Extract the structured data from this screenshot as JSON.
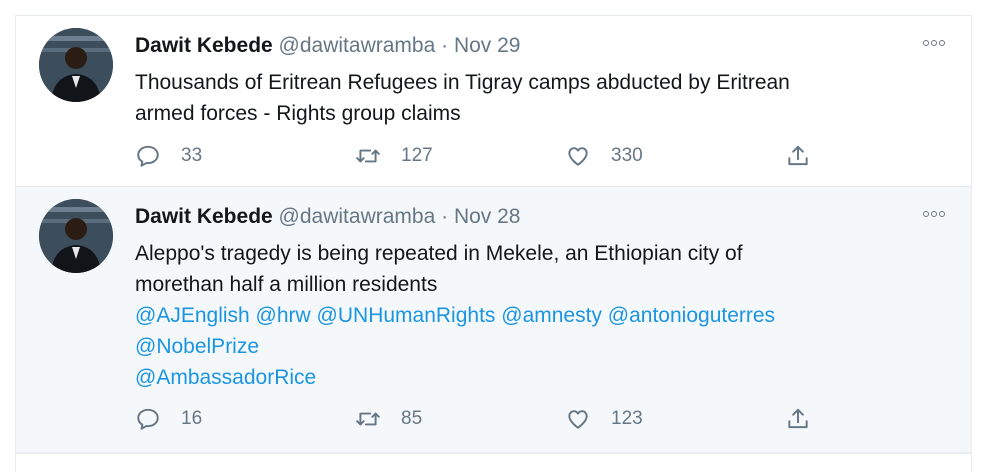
{
  "tweets": [
    {
      "author_name": "Dawit Kebede",
      "handle": "@dawitawramba",
      "separator": "·",
      "date": "Nov 29",
      "text_lines": [
        "Thousands of Eritrean Refugees in Tigray camps abducted by Eritrean",
        "armed forces - Rights group claims"
      ],
      "replies": "33",
      "retweets": "127",
      "likes": "330"
    },
    {
      "author_name": "Dawit Kebede",
      "handle": "@dawitawramba",
      "separator": "·",
      "date": "Nov 28",
      "text_lines": [
        "Aleppo's tragedy is being repeated in Mekele, an Ethiopian city of",
        "morethan half a million residents"
      ],
      "mentions": [
        "@AJEnglish",
        "@hrw",
        "@UNHumanRights",
        "@amnesty",
        "@antonioguterres",
        "@NobelPrize",
        "@AmbassadorRice"
      ],
      "replies": "16",
      "retweets": "85",
      "likes": "123"
    }
  ],
  "icons": {
    "reply": "reply-icon",
    "retweet": "retweet-icon",
    "like": "heart-icon",
    "share": "share-icon",
    "more": "more-options-icon"
  },
  "colors": {
    "link": "#1b95e0",
    "secondary_text": "#657786",
    "highlight_background": "#f5f8fa",
    "border": "#e6ecf0"
  }
}
